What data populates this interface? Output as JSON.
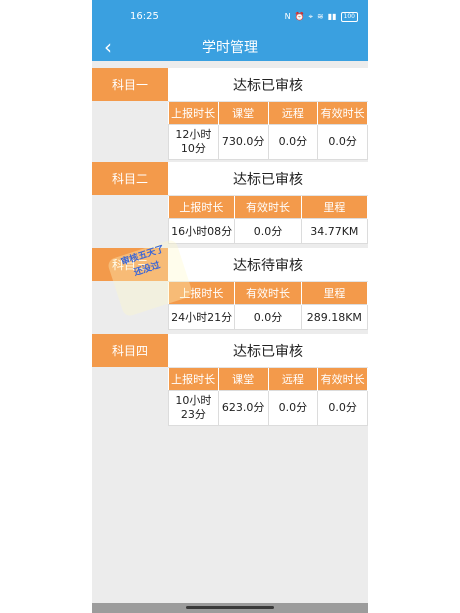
{
  "status": {
    "time": "16:25",
    "battery": "100"
  },
  "header": {
    "title": "学时管理",
    "back_symbol": "‹"
  },
  "subjects": [
    {
      "label": "科目一",
      "status": "达标已审核",
      "headers": [
        "上报时长",
        "课堂",
        "远程",
        "有效时长"
      ],
      "values": [
        "12小时\n10分",
        "730.0分",
        "0.0分",
        "0.0分"
      ]
    },
    {
      "label": "科目二",
      "status": "达标已审核",
      "headers": [
        "上报时长",
        "有效时长",
        "里程"
      ],
      "values": [
        "16小时08分",
        "0.0分",
        "34.77KM"
      ]
    },
    {
      "label": "科目三",
      "status": "达标待审核",
      "headers": [
        "上报时长",
        "有效时长",
        "里程"
      ],
      "values": [
        "24小时21分",
        "0.0分",
        "289.18KM"
      ]
    },
    {
      "label": "科目四",
      "status": "达标已审核",
      "headers": [
        "上报时长",
        "课堂",
        "远程",
        "有效时长"
      ],
      "values": [
        "10小时\n23分",
        "623.0分",
        "0.0分",
        "0.0分"
      ]
    }
  ]
}
